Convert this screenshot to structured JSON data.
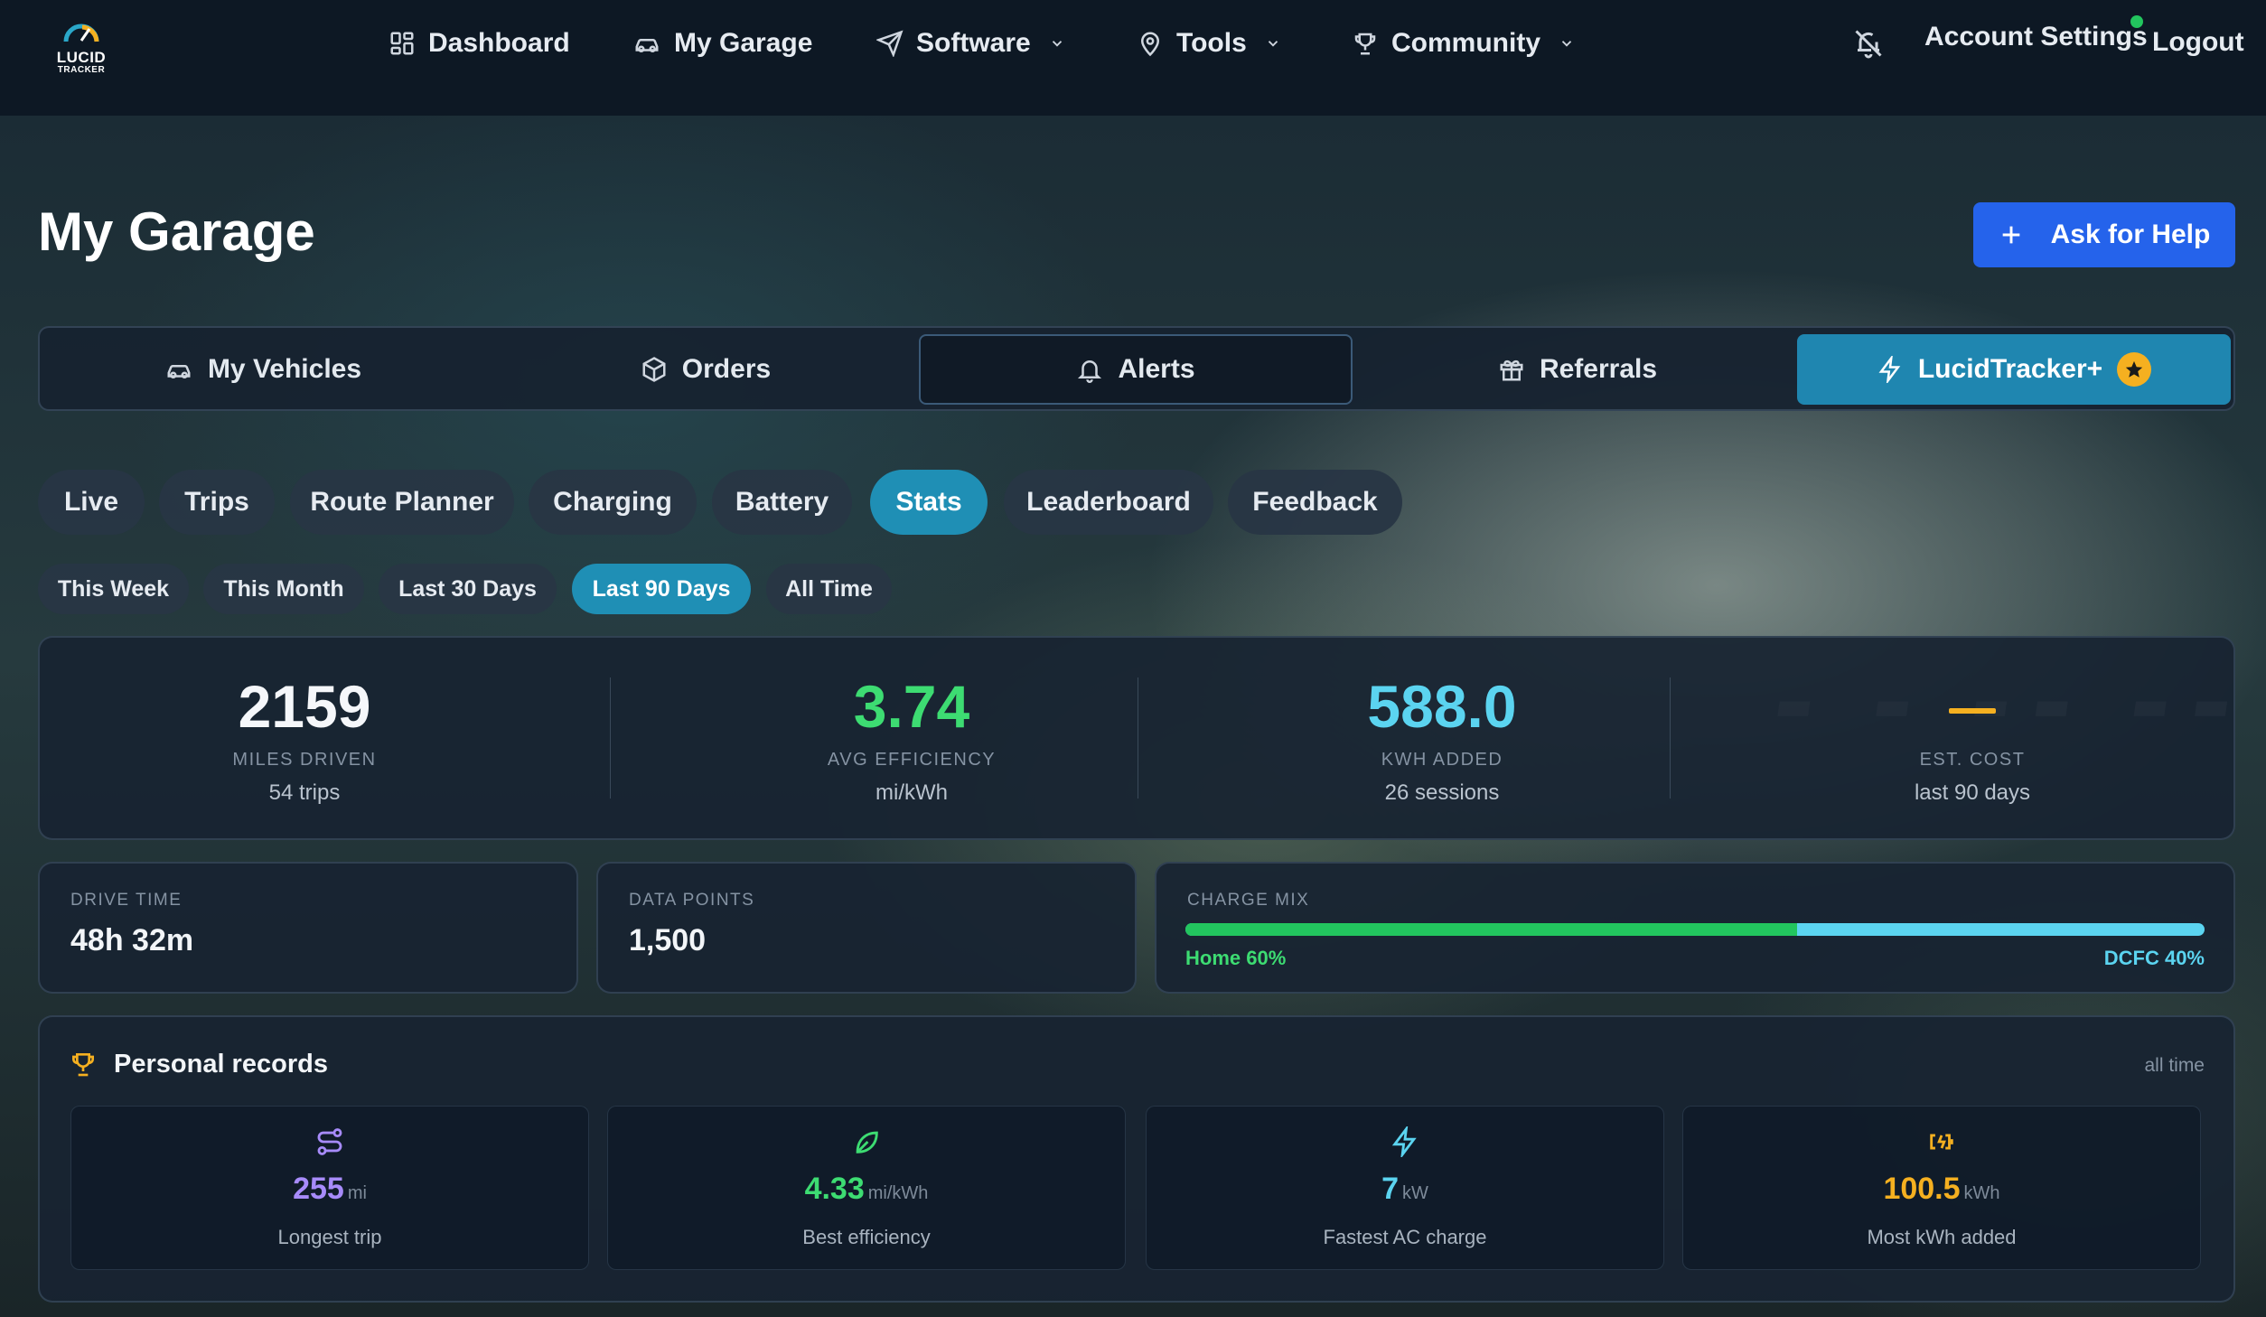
{
  "app": {
    "logo_line1": "LUCID",
    "logo_line2": "TRACKER"
  },
  "nav": {
    "items": [
      {
        "label": "Dashboard",
        "icon": "grid-icon"
      },
      {
        "label": "My Garage",
        "icon": "car-icon"
      },
      {
        "label": "Software",
        "icon": "send-icon",
        "dropdown": true
      },
      {
        "label": "Tools",
        "icon": "map-pin-icon",
        "dropdown": true
      },
      {
        "label": "Community",
        "icon": "trophy-icon",
        "dropdown": true
      }
    ],
    "account": "Account Settings",
    "logout": "Logout"
  },
  "page": {
    "title": "My Garage",
    "help_button": "Ask for Help"
  },
  "main_tabs": [
    {
      "label": "My Vehicles",
      "icon": "car-icon"
    },
    {
      "label": "Orders",
      "icon": "package-icon"
    },
    {
      "label": "Alerts",
      "icon": "bell-icon"
    },
    {
      "label": "Referrals",
      "icon": "gift-icon"
    },
    {
      "label": "LucidTracker+",
      "icon": "lightning-icon"
    }
  ],
  "sub_tabs": [
    "Live",
    "Trips",
    "Route Planner",
    "Charging",
    "Battery",
    "Stats",
    "Leaderboard",
    "Feedback"
  ],
  "sub_tab_active": "Stats",
  "ranges": [
    "This Week",
    "This Month",
    "Last 30 Days",
    "Last 90 Days",
    "All Time"
  ],
  "range_active": "Last 90 Days",
  "summary": {
    "miles": {
      "value": "2159",
      "label": "MILES DRIVEN",
      "sub": "54 trips"
    },
    "efficiency": {
      "value": "3.74",
      "label": "AVG EFFICIENCY",
      "sub": "mi/kWh"
    },
    "kwh": {
      "value": "588.0",
      "label": "KWH ADDED",
      "sub": "26 sessions"
    },
    "cost": {
      "value": "",
      "label": "EST. COST",
      "sub": "last 90 days"
    }
  },
  "drive_time": {
    "label": "DRIVE TIME",
    "value": "48h 32m"
  },
  "data_points": {
    "label": "DATA POINTS",
    "value": "1,500"
  },
  "charge_mix": {
    "label": "CHARGE MIX",
    "home_pct": 60,
    "dcfc_pct": 40,
    "home_label": "Home 60%",
    "dcfc_label": "DCFC 40%"
  },
  "records": {
    "title": "Personal records",
    "scope": "all time",
    "items": [
      {
        "value": "255",
        "unit": "mi",
        "label": "Longest trip",
        "icon": "route-icon",
        "color": "#a78bfa"
      },
      {
        "value": "4.33",
        "unit": "mi/kWh",
        "label": "Best efficiency",
        "icon": "leaf-icon",
        "color": "#3ddc72"
      },
      {
        "value": "7",
        "unit": "kW",
        "label": "Fastest AC charge",
        "icon": "lightning-icon",
        "color": "#5bd4f0"
      },
      {
        "value": "100.5",
        "unit": "kWh",
        "label": "Most kWh added",
        "icon": "battery-charging-icon",
        "color": "#f5b020"
      }
    ]
  },
  "colors": {
    "accent": "#1f8fb5",
    "help": "#2563eb",
    "green": "#3ddc72",
    "cyan": "#5bd4f0",
    "amber": "#f5b020"
  }
}
